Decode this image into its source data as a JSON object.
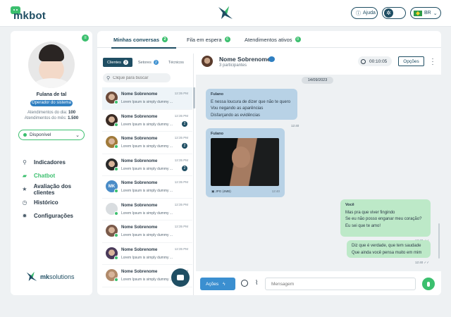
{
  "brand": {
    "name": "mkbot"
  },
  "header": {
    "help_label": "Ajuda",
    "language": "BR"
  },
  "profile": {
    "name": "Fulana de tal",
    "role": "Operador do sistema",
    "stats": [
      {
        "label": "Atendimentos do dia:",
        "value": "100"
      },
      {
        "label": "Atendimentos do mês:",
        "value": "1.500"
      }
    ],
    "status": "Disponível"
  },
  "nav": [
    {
      "label": "Indicadores",
      "icon": "chart-icon",
      "active": false
    },
    {
      "label": "Chatbot",
      "icon": "chat-icon",
      "active": true
    },
    {
      "label": "Avaliação dos clientes",
      "icon": "star-icon",
      "active": false
    },
    {
      "label": "Histórico",
      "icon": "history-icon",
      "active": false
    },
    {
      "label": "Configurações",
      "icon": "gear-icon",
      "active": false
    }
  ],
  "footer_brand": {
    "prefix": "mk",
    "name": "solutions"
  },
  "top_tabs": [
    {
      "label": "Minhas conversas",
      "count": "2",
      "active": true
    },
    {
      "label": "Fila em espera",
      "count": "6",
      "active": false
    },
    {
      "label": "Atendimentos ativos",
      "count": "0",
      "active": false
    }
  ],
  "sub_tabs": [
    {
      "label": "Clientes",
      "count": "3",
      "active": true
    },
    {
      "label": "Setores",
      "count": "2",
      "active": false
    },
    {
      "label": "Técnicos",
      "count": "",
      "active": false
    }
  ],
  "search": {
    "placeholder": "Clique para buscar"
  },
  "conversations": [
    {
      "name": "Nome Sobrenome",
      "preview": "Lorem Ipsum is simply dummy ...",
      "time": "12:35 PM",
      "unread": "",
      "avatar": "photo",
      "color": "#6b4a3a",
      "selected": true
    },
    {
      "name": "Nome Sobrenome",
      "preview": "Lorem Ipsum is simply dummy ...",
      "time": "12:35 PM",
      "unread": "2",
      "avatar": "photo",
      "color": "#3a2b24"
    },
    {
      "name": "Nome Sobrenome",
      "preview": "Lorem Ipsum is simply dummy ...",
      "time": "12:35 PM",
      "unread": "2",
      "avatar": "photo",
      "color": "#a07a3a"
    },
    {
      "name": "Nome Sobrenome",
      "preview": "Lorem Ipsum is simply dummy ...",
      "time": "12:35 PM",
      "unread": "2",
      "avatar": "photo",
      "color": "#2a2a2a"
    },
    {
      "name": "Nome Sobrenome",
      "preview": "Lorem Ipsum is simply dummy ...",
      "time": "12:35 PM",
      "unread": "",
      "avatar": "initials",
      "initials": "MK"
    },
    {
      "name": "Nome Sobrenome",
      "preview": "Lorem Ipsum is simply dummy ...",
      "time": "12:35 PM",
      "unread": "",
      "avatar": "generic"
    },
    {
      "name": "Nome Sobrenome",
      "preview": "Lorem Ipsum is simply dummy ...",
      "time": "12:35 PM",
      "unread": "",
      "avatar": "photo",
      "color": "#7a5a4a"
    },
    {
      "name": "Nome Sobrenome",
      "preview": "Lorem Ipsum is simply dummy ...",
      "time": "12:35 PM",
      "unread": "",
      "avatar": "photo",
      "color": "#4a3a5a"
    },
    {
      "name": "Nome Sobrenome",
      "preview": "Lorem Ipsum is simply dummy ...",
      "time": "12:35 PM",
      "unread": "",
      "avatar": "photo",
      "color": "#b08a6a"
    }
  ],
  "chat": {
    "contact_name": "Nome Sobrenome",
    "participants": "3 participantes",
    "timer": "00:10:05",
    "options_label": "Opções",
    "date": "14/09/2023",
    "messages": [
      {
        "author": "Fulano",
        "lines": [
          "E nessa loucura de dizer que não te quero",
          "Vou negando as aparências",
          "Disfarçando as evidências"
        ],
        "time": "12:40"
      },
      {
        "author": "Fulano",
        "file": "JPG (4MB)",
        "time": "12:40"
      },
      {
        "author": "Você",
        "lines": [
          "Mas pra que viver fingindo",
          "Se eu não posso enganar meu coração?",
          "Eu sei que te amo!"
        ],
        "time": "12:40"
      },
      {
        "lines": [
          "Diz que é verdade, que tem saudade",
          "Que ainda você pensa muito em mim"
        ],
        "time": "12:40"
      }
    ],
    "actions_label": "Ações",
    "input_placeholder": "Mensagem"
  },
  "colors": {
    "primary": "#1f4e63",
    "accent_green": "#3bbf6e",
    "accent_blue": "#3b8fd0",
    "bubble_in": "#b8d2e6",
    "bubble_out": "#bde9c8"
  }
}
